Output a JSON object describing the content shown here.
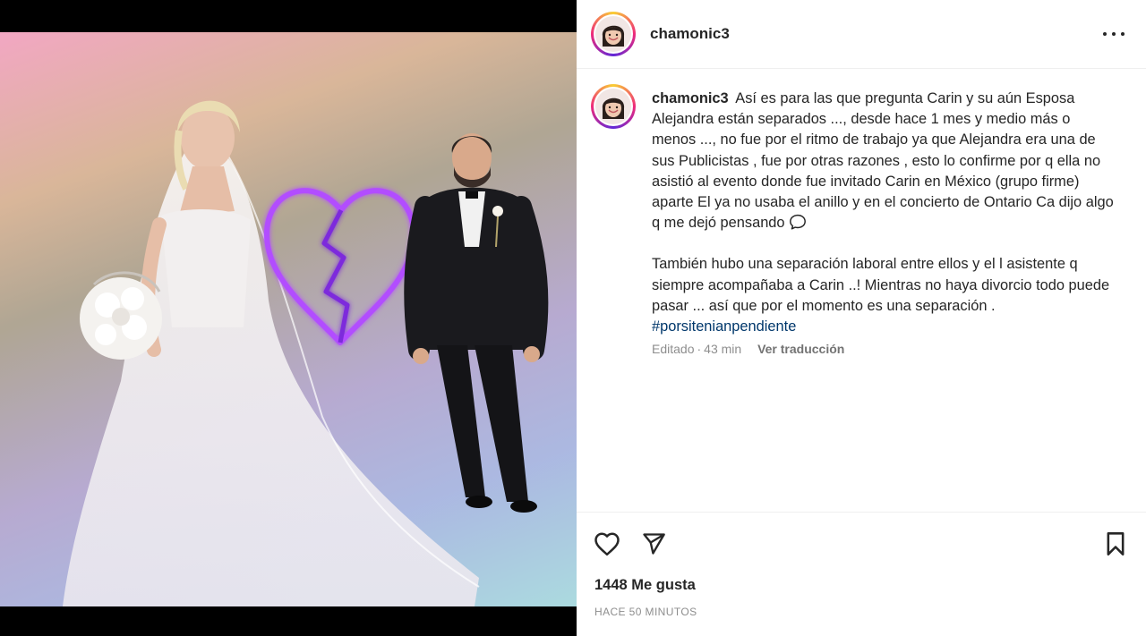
{
  "post": {
    "username": "chamonic3",
    "caption": {
      "author": "chamonic3",
      "paragraph1": "Así es para las que pregunta Carin y su aún Esposa Alejandra están separados ..., desde hace 1 mes y medio más o menos ..., no fue por el ritmo de trabajo ya que Alejandra era una de sus Publicistas , fue por otras razones , esto lo confirme por q ella no asistió al evento donde fue invitado Carin en México (grupo firme) aparte El ya no usaba el anillo y en el concierto de Ontario Ca dijo algo q me dejó pensando",
      "paragraph2": "También hubo una separación laboral entre ellos y el l asistente q siempre acompañaba a Carin ..! Mientras no haya divorcio todo puede pasar ... así que por el momento es una separación .",
      "hashtag": "#porsitenianpendiente",
      "edited_label": "Editado",
      "separator": "·",
      "age": "43 min",
      "translate_label": "Ver traducción"
    },
    "likes_text": "1448 Me gusta",
    "timestamp": "HACE 50 MINUTOS",
    "icons": {
      "more": "more-options-icon",
      "like": "heart-icon",
      "share": "paper-plane-icon",
      "save": "bookmark-icon",
      "speech": "speech-bubble-icon",
      "broken_heart": "broken-heart-icon"
    },
    "colors": {
      "hashtag": "#00376b",
      "muted": "#8e8e8e",
      "text": "#262626",
      "neon_heart": "#a63cff"
    }
  }
}
